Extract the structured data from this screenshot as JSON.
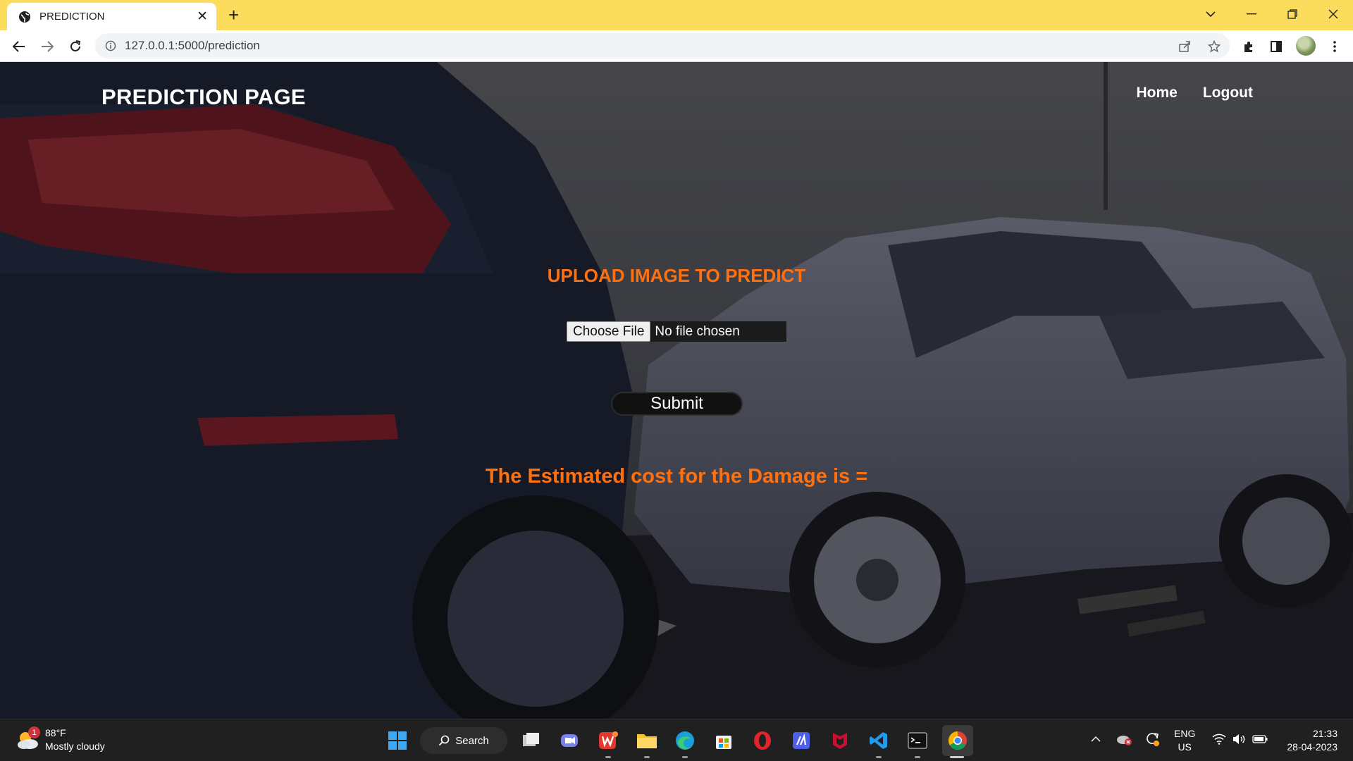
{
  "browser": {
    "tab_title": "PREDICTION",
    "url": "127.0.0.1:5000/prediction"
  },
  "page": {
    "brand": "PREDICTION PAGE",
    "nav": [
      {
        "label": "Home"
      },
      {
        "label": "Logout"
      }
    ],
    "upload_title": "UPLOAD IMAGE TO PREDICT",
    "file_button": "Choose File",
    "file_status": "No file chosen",
    "submit_label": "Submit",
    "result_text": "The Estimated cost for the Damage is ="
  },
  "taskbar": {
    "weather_temp": "88°F",
    "weather_desc": "Mostly cloudy",
    "weather_badge": "1",
    "search_label": "Search",
    "lang_top": "ENG",
    "lang_bottom": "US",
    "time": "21:33",
    "date": "28-04-2023"
  },
  "colors": {
    "tabstrip": "#fbdc5d",
    "accent_orange": "#ff7010",
    "taskbar": "#202020"
  }
}
